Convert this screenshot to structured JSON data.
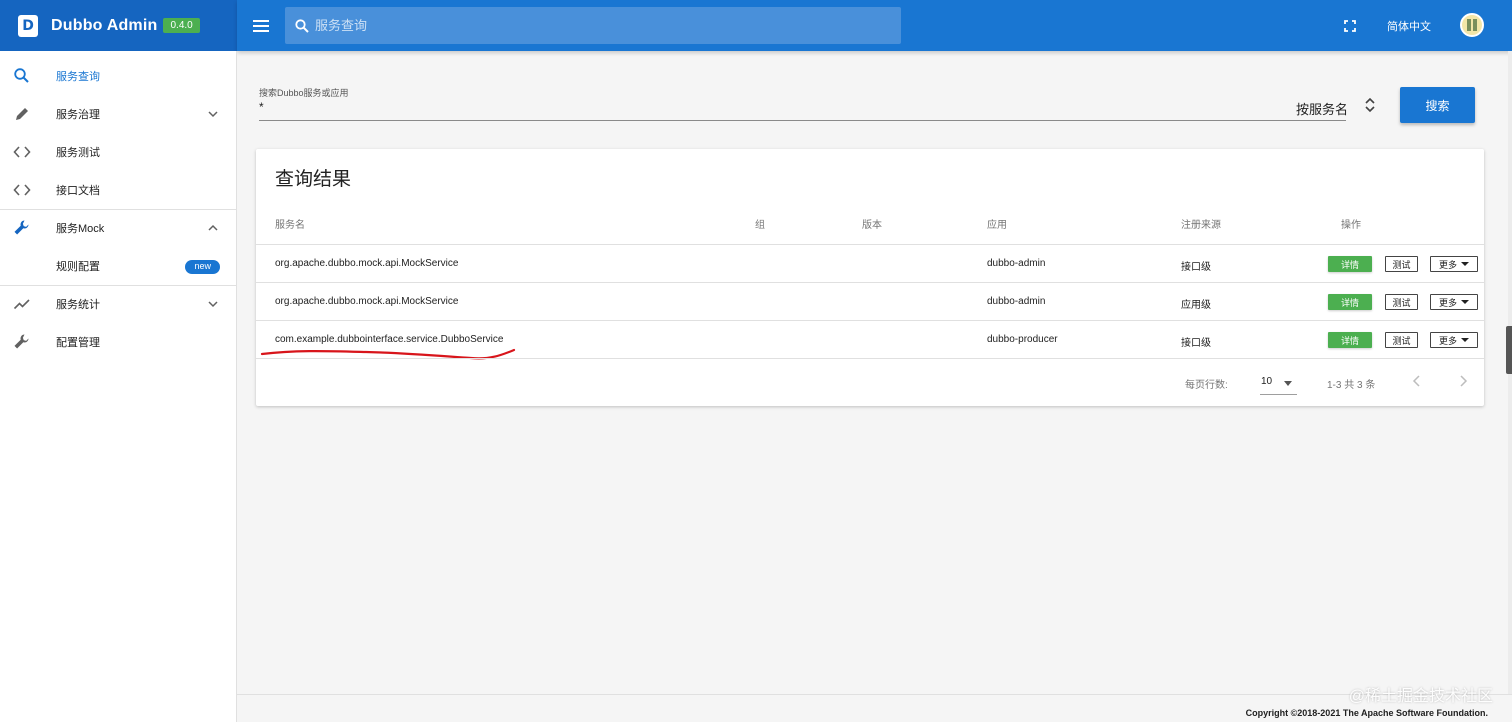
{
  "app": {
    "title": "Dubbo Admin",
    "version": "0.4.0",
    "logo_letter": "D",
    "primary_color": "#1976d2",
    "brand_color": "#1565c0",
    "version_badge_color": "#4caf50"
  },
  "toolbar": {
    "menu_icon": "menu-icon",
    "search_placeholder": "服务查询",
    "fullscreen_icon": "fullscreen-icon",
    "language": "简体中文"
  },
  "sidebar": {
    "items": [
      {
        "label": "服务查询",
        "icon": "search-icon",
        "active": true
      },
      {
        "label": "服务治理",
        "icon": "pencil-icon",
        "expandable": true,
        "expanded": false
      },
      {
        "label": "服务测试",
        "icon": "code-icon"
      },
      {
        "label": "接口文档",
        "icon": "code-icon"
      },
      {
        "label": "服务Mock",
        "icon": "wrench-icon",
        "expandable": true,
        "expanded": true
      },
      {
        "label": "规则配置",
        "badge": "new",
        "child": true
      },
      {
        "label": "服务统计",
        "icon": "trending-icon",
        "expandable": true,
        "expanded": false
      },
      {
        "label": "配置管理",
        "icon": "wrench-icon"
      }
    ]
  },
  "search": {
    "label": "搜索Dubbo服务或应用",
    "value": "*",
    "sort_by": "按服务名",
    "button": "搜索"
  },
  "results": {
    "title": "查询结果",
    "columns": [
      "服务名",
      "组",
      "版本",
      "应用",
      "注册来源",
      "操作"
    ],
    "rows": [
      {
        "service": "org.apache.dubbo.mock.api.MockService",
        "group": "",
        "version": "",
        "app": "dubbo-admin",
        "source": "接口级"
      },
      {
        "service": "org.apache.dubbo.mock.api.MockService",
        "group": "",
        "version": "",
        "app": "dubbo-admin",
        "source": "应用级"
      },
      {
        "service": "com.example.dubbointerface.service.DubboService",
        "group": "",
        "version": "",
        "app": "dubbo-producer",
        "source": "接口级"
      }
    ],
    "actions": {
      "detail": "详情",
      "test": "测试",
      "more": "更多"
    },
    "pagination": {
      "rows_per_page_label": "每页行数:",
      "rows_per_page": "10",
      "range": "1-3 共 3 条"
    }
  },
  "footer": {
    "copyright": "Copyright ©2018-2021 The Apache Software Foundation."
  },
  "watermark": "@稀土掘金技术社区"
}
